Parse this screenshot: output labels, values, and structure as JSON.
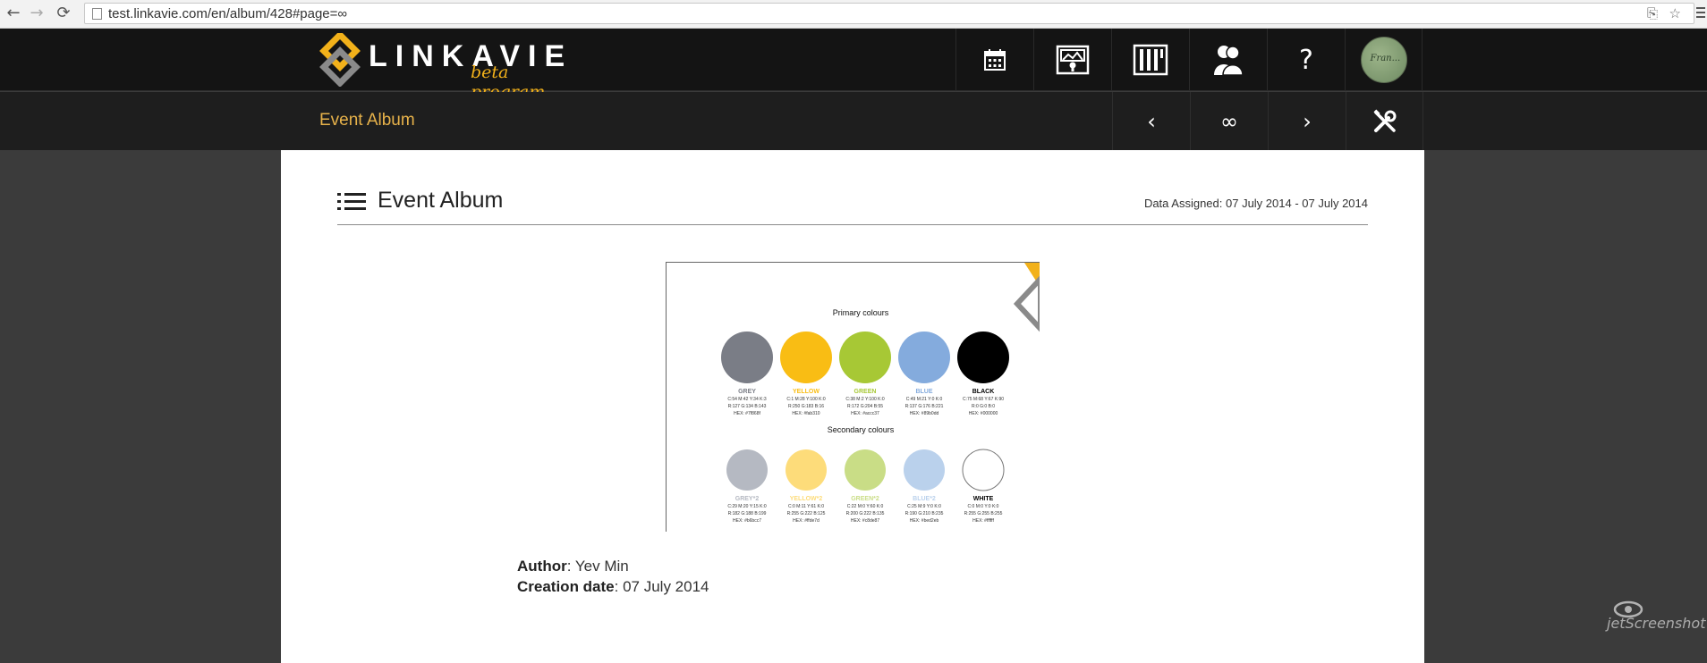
{
  "browser": {
    "back": "←",
    "forward": "→",
    "reload": "⟳",
    "url": "test.linkavie.com/en/album/428#page=∞",
    "translate_icon": "⎘",
    "star_icon": "☆"
  },
  "header": {
    "brand": "LINKAVIE",
    "tagline": "beta program",
    "help": "?",
    "avatar_text": "Fran...",
    "colors": {
      "accent": "#f2b11a",
      "bg": "#141414"
    }
  },
  "subbar": {
    "title": "Event Album",
    "prev": "‹",
    "infinity": "∞",
    "next": "›"
  },
  "content": {
    "title": "Event Album",
    "dates": "Data Assigned: 07 July 2014 - 07 July 2014",
    "image": {
      "primary_heading": "Primary colours",
      "secondary_heading": "Secondary colours",
      "primary": [
        {
          "name": "GREY",
          "color": "#7a7d86",
          "l1": "C:54 M:42 Y:34 K:3",
          "l2": "R:127 G:134 B:143",
          "l3": "HEX: #7f868f"
        },
        {
          "name": "YELLOW",
          "color": "#f9bd14",
          "l1": "C:1 M:28 Y:100 K:0",
          "l2": "R:250 G:183 B:16",
          "l3": "HEX: #fab310"
        },
        {
          "name": "GREEN",
          "color": "#a7c835",
          "l1": "C:38 M:2 Y:100 K:0",
          "l2": "R:172 G:204 B:55",
          "l3": "HEX: #accc37"
        },
        {
          "name": "BLUE",
          "color": "#84abdd",
          "l1": "C:49 M:21 Y:0 K:0",
          "l2": "R:137 G:176 B:221",
          "l3": "HEX: #89b0dd"
        },
        {
          "name": "BLACK",
          "color": "#000000",
          "l1": "C:75 M:68 Y:67 K:90",
          "l2": "R:0 G:0 B:0",
          "l3": "HEX: #000000"
        }
      ],
      "secondary": [
        {
          "name": "GREY*2",
          "color": "#b5b9c2",
          "l1": "C:29 M:20 Y:15 K:0",
          "l2": "R:182 G:188 B:199",
          "l3": "HEX: #b6bcc7"
        },
        {
          "name": "YELLOW*2",
          "color": "#fddc7a",
          "l1": "C:0 M:11 Y:61 K:0",
          "l2": "R:255 G:222 B:125",
          "l3": "HEX: #ffde7d"
        },
        {
          "name": "GREEN*2",
          "color": "#c9dd86",
          "l1": "C:22 M:0 Y:60 K:0",
          "l2": "R:200 G:222 B:135",
          "l3": "HEX: #c8de87"
        },
        {
          "name": "BLUE*2",
          "color": "#bad1ec",
          "l1": "C:25 M:9 Y:0 K:0",
          "l2": "R:190 G:210 B:235",
          "l3": "HEX: #bed2eb"
        },
        {
          "name": "WHITE",
          "color": "#ffffff",
          "l1": "C:0 M:0 Y:0 K:0",
          "l2": "R:255 G:255 B:255",
          "l3": "HEX: #ffffff"
        }
      ]
    },
    "author_label": "Author",
    "author": "Yev Min",
    "creation_label": "Creation date",
    "creation_date": "07 July 2014"
  },
  "watermark": "jetScreenshot"
}
